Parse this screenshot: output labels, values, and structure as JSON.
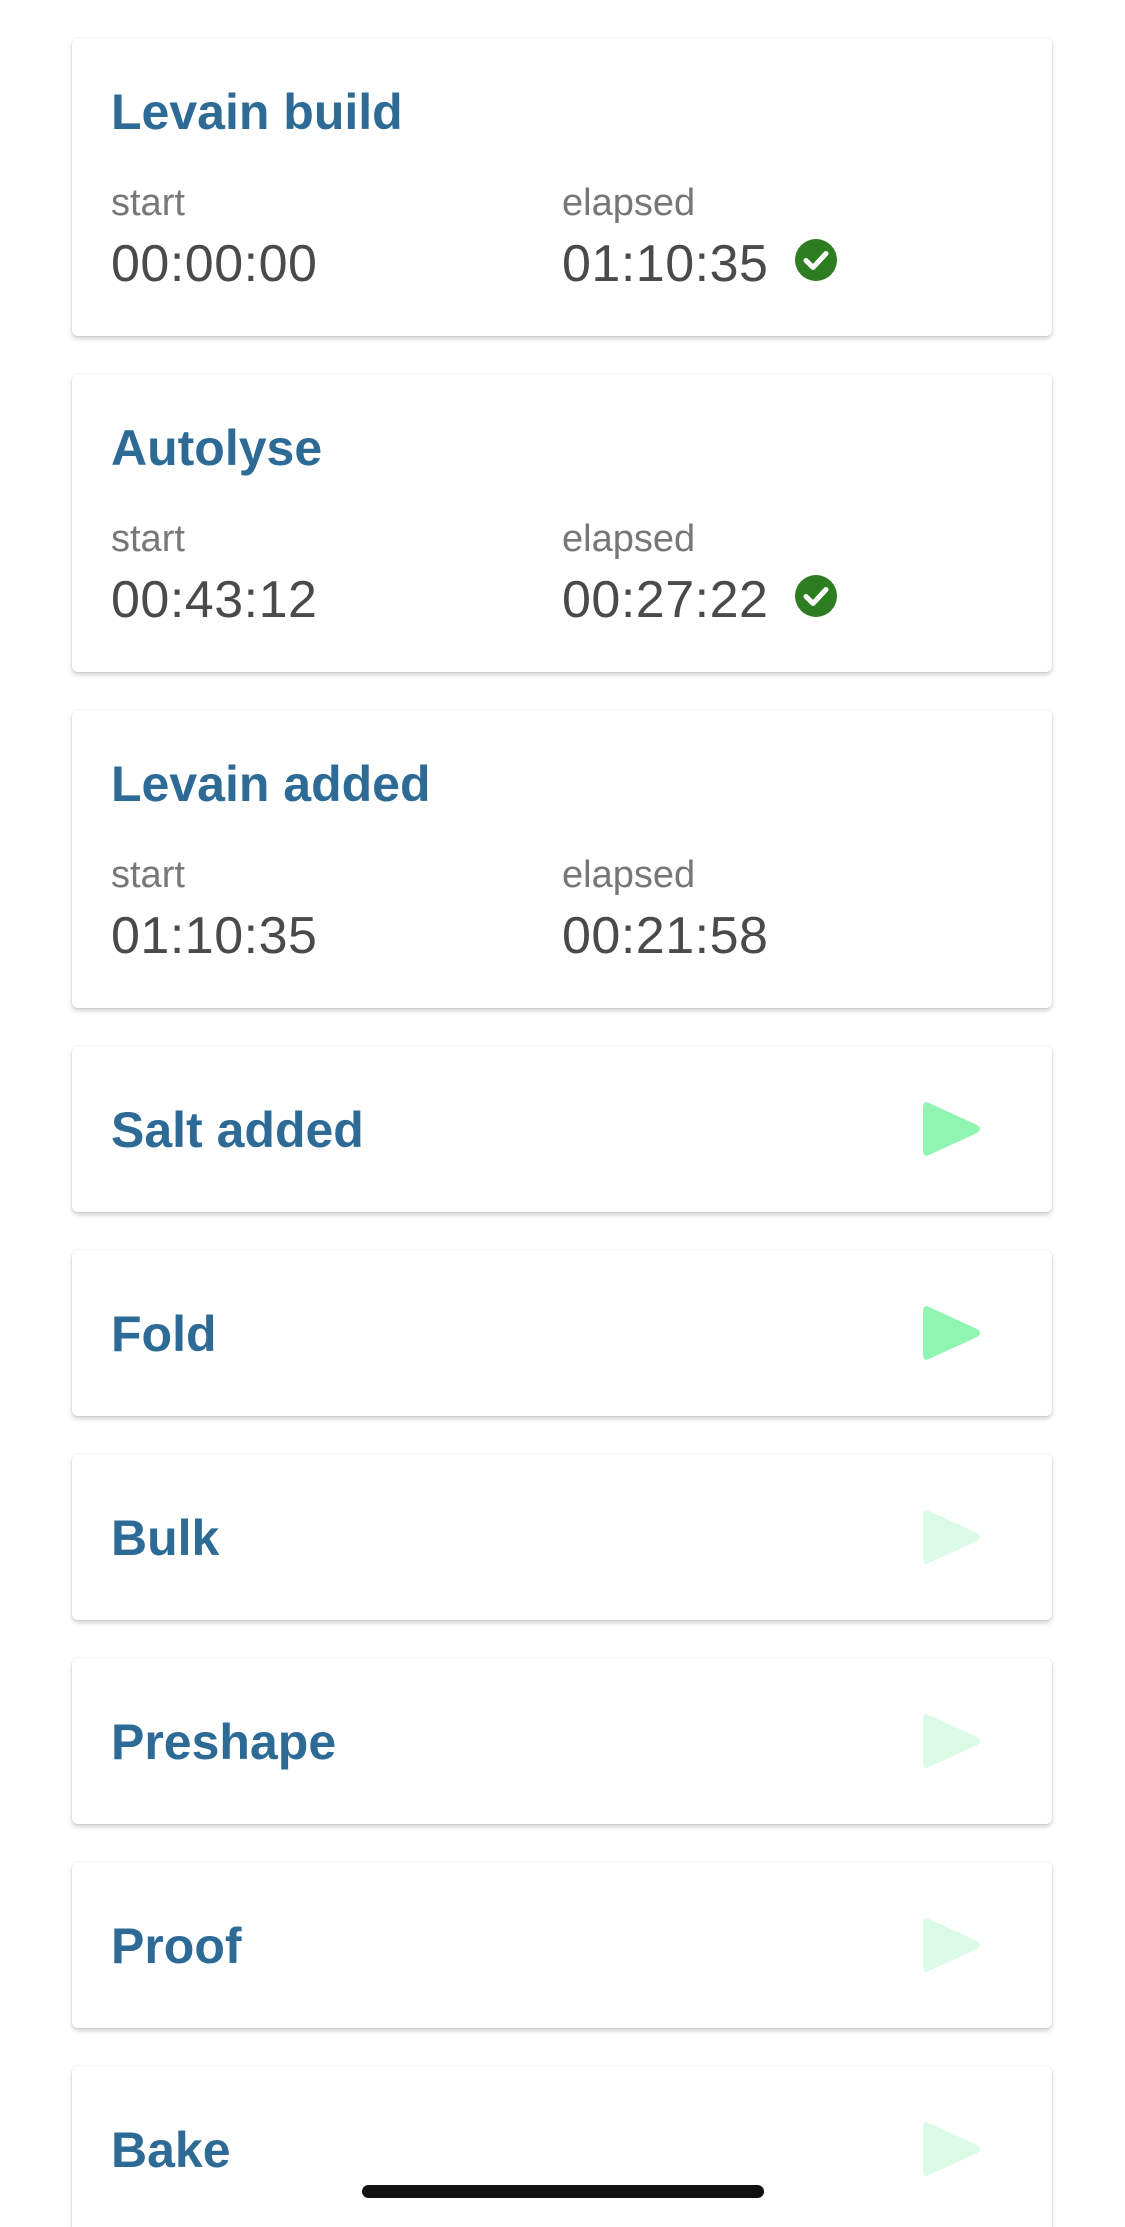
{
  "colors": {
    "title": "#2d6a96",
    "label": "#777777",
    "value": "#4a4a4a",
    "check": "#2e7d22",
    "play_active": "#8ff5b0",
    "play_inactive": "#dcfbe6"
  },
  "steps": [
    {
      "title": "Levain build",
      "start_label": "start",
      "start_value": "00:00:00",
      "elapsed_label": "elapsed",
      "elapsed_value": "01:10:35",
      "status_icon": "check-circle-icon"
    },
    {
      "title": "Autolyse",
      "start_label": "start",
      "start_value": "00:43:12",
      "elapsed_label": "elapsed",
      "elapsed_value": "00:27:22",
      "status_icon": "check-circle-icon"
    },
    {
      "title": "Levain added",
      "start_label": "start",
      "start_value": "01:10:35",
      "elapsed_label": "elapsed",
      "elapsed_value": "00:21:58"
    },
    {
      "title": "Salt added",
      "play_icon": "play-icon",
      "play_enabled": true
    },
    {
      "title": "Fold",
      "play_icon": "play-icon",
      "play_enabled": true
    },
    {
      "title": "Bulk",
      "play_icon": "play-icon",
      "play_enabled": false
    },
    {
      "title": "Preshape",
      "play_icon": "play-icon",
      "play_enabled": false
    },
    {
      "title": "Proof",
      "play_icon": "play-icon",
      "play_enabled": false
    },
    {
      "title": "Bake",
      "play_icon": "play-icon",
      "play_enabled": false
    }
  ]
}
